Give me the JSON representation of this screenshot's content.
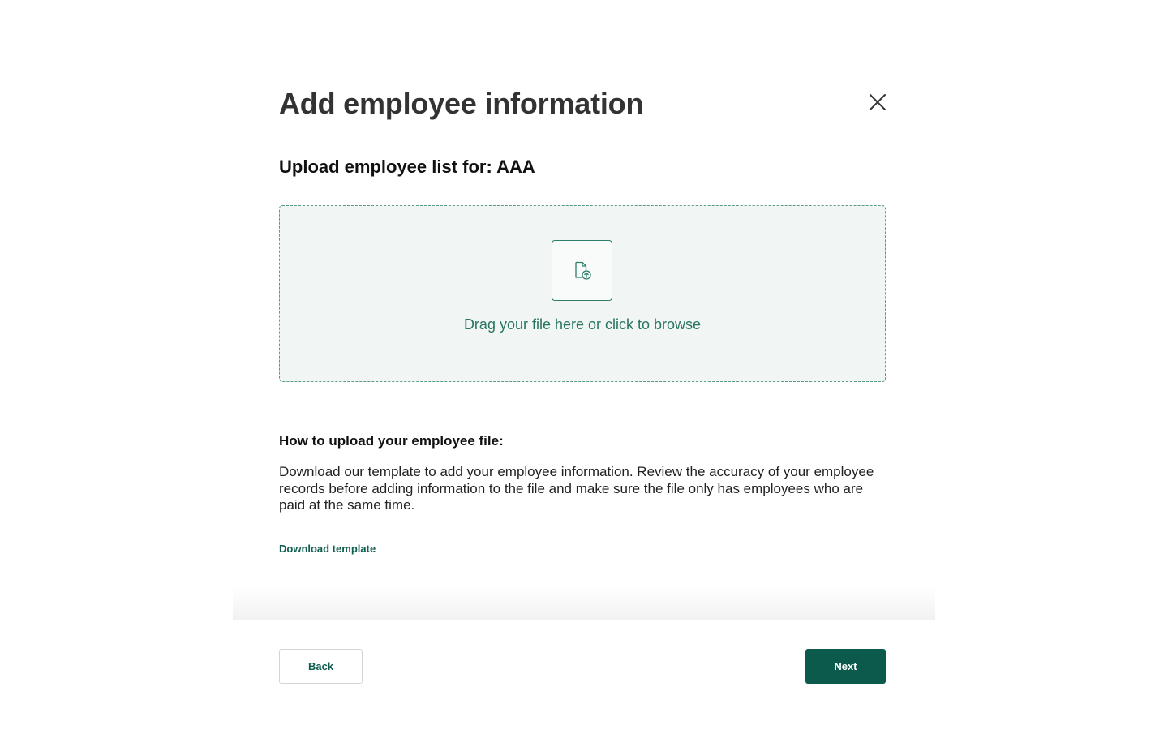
{
  "modal": {
    "title": "Add employee information",
    "close_label": "Close",
    "section_title": "Upload employee list for: AAA",
    "dropzone": {
      "icon": "file-upload-icon",
      "text": "Drag your file here or click to browse"
    },
    "howto": {
      "title": "How to upload your employee file:",
      "body": "Download our template to add your employee information. Review the accuracy of your employee records before adding information to the file and make sure the file only has employees who are paid at the same time.",
      "link_label": "Download template"
    },
    "footer": {
      "back_label": "Back",
      "next_label": "Next"
    }
  },
  "colors": {
    "primary": "#0c5a4c",
    "link": "#0f5e4f",
    "dropzone_bg": "#f1f6f4",
    "dropzone_border": "#5a9a88",
    "title": "#333333"
  }
}
